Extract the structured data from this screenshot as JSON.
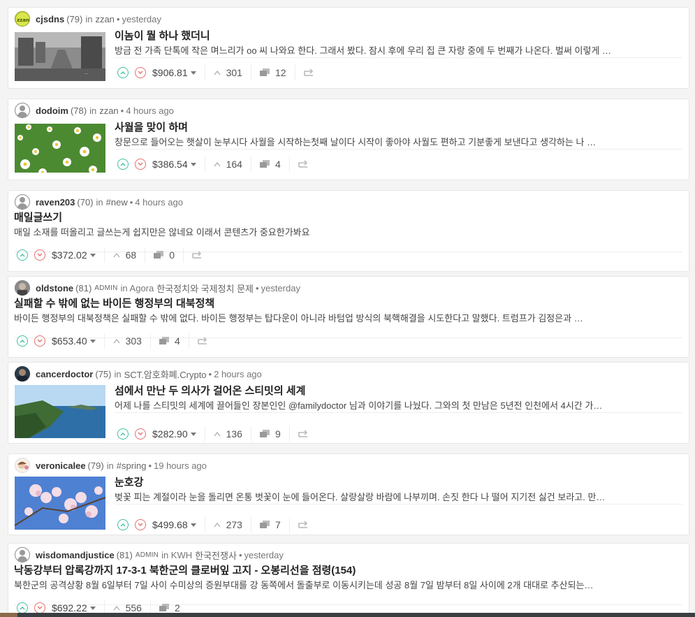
{
  "posts": [
    {
      "author": "cjsdns",
      "rep": "(79)",
      "admin": "",
      "in": "in",
      "category": "zzan",
      "time": "yesterday",
      "avatar": "zzan-logo",
      "thumb": "city-street-photo",
      "title": "이놈이 뭘 하나 했더니",
      "snippet": "방금 전 가족 단톡에 작은 며느리가 oo 씨 나와요 한다. 그래서 봤다. 잠시 후에 우리 집 큰 자랑 중에 두 번째가 나온다. 벌써 이렇게 …",
      "payout": "$906.81",
      "votes": "301",
      "comments": "12"
    },
    {
      "author": "dodoim",
      "rep": "(78)",
      "admin": "",
      "in": "in",
      "category": "zzan",
      "time": "4 hours ago",
      "avatar": "default",
      "thumb": "daisy-flowers-photo",
      "title": "사월을 맞이 하며",
      "snippet": "창문으로 들어오는 햇살이 눈부시다 사월을 시작하는첫째 날이다 시작이 좋아야 사월도 편하고 기분좋게 보낸다고 생각하는 나 …",
      "payout": "$386.54",
      "votes": "164",
      "comments": "4"
    },
    {
      "author": "raven203",
      "rep": "(70)",
      "admin": "",
      "in": "in",
      "category": "#new",
      "time": "4 hours ago",
      "avatar": "default",
      "thumb": "",
      "title": "매일글쓰기",
      "snippet": "매일 소재를 떠올리고 글쓰는게 쉽지만은 않네요 이래서 콘텐츠가 중요한가봐요",
      "payout": "$372.02",
      "votes": "68",
      "comments": "0"
    },
    {
      "author": "oldstone",
      "rep": "(81)",
      "admin": "ADMIN",
      "in": "in Agora",
      "category": "한국정치와 국제정치 문제",
      "time": "yesterday",
      "avatar": "photo",
      "thumb": "",
      "title": "실패할 수 밖에 없는 바이든 행정부의 대북정책",
      "snippet": "바이든 행정부의 대북정책은 실패할 수 밖에 없다. 바이든 행정부는 탑다운이 아니라 바텀업 방식의 북핵해결을 시도한다고 말했다. 트럼프가 김정은과 …",
      "payout": "$653.40",
      "votes": "303",
      "comments": "4"
    },
    {
      "author": "cancerdoctor",
      "rep": "(75)",
      "admin": "",
      "in": "in",
      "category": "SCT.암호화폐.Crypto",
      "time": "2 hours ago",
      "avatar": "photo-dark",
      "thumb": "island-sea-photo",
      "title": "섬에서 만난 두 의사가 걸어온 스티밋의 세계",
      "snippet": "어제 나를 스티밋의 세계에 끌어들인 장본인인 @familydoctor 님과 이야기를 나눴다. 그와의 첫 만남은 5년전 인천에서 4시간 가…",
      "payout": "$282.90",
      "votes": "136",
      "comments": "9"
    },
    {
      "author": "veronicalee",
      "rep": "(79)",
      "admin": "",
      "in": "in",
      "category": "#spring",
      "time": "19 hours ago",
      "avatar": "illustration",
      "thumb": "cherry-blossom-photo",
      "title": "눈호강",
      "snippet": "벚꽃 피는 계절이라 눈을 돌리면 온통 벗꽃이 눈에 들어온다. 살랑살랑 바람에 나부끼며. 손짓 한다 나 떨어 지기전 싫건 보라고. 만…",
      "payout": "$499.68",
      "votes": "273",
      "comments": "7"
    },
    {
      "author": "wisdomandjustice",
      "rep": "(81)",
      "admin": "ADMIN",
      "in": "in KWH",
      "category": "한국전쟁사",
      "time": "yesterday",
      "avatar": "default",
      "thumb": "",
      "title": "낙동강부터 압록강까지 17-3-1 북한군의 클로버잎 고지 - 오봉리선을 점령(154)",
      "snippet": "북한군의 공격상황 8월 6일부터 7일 사이 수미상의 증원부대를 강 동쪽에서 돌출부로 이동시키는데 성공 8월 7일 밤부터 8일 사이에 2개 대대로 추산되는…",
      "payout": "$692.22",
      "votes": "556",
      "comments": "2"
    }
  ],
  "colors": {
    "upvote": "#3fc0a1",
    "downvote": "#e66f6f",
    "background": "#f4f4f4"
  },
  "icons": {
    "upvote": "chevron-up-icon",
    "downvote": "chevron-down-icon",
    "votes": "caret-up-icon",
    "comments": "comments-icon",
    "reblog": "reblog-icon"
  }
}
